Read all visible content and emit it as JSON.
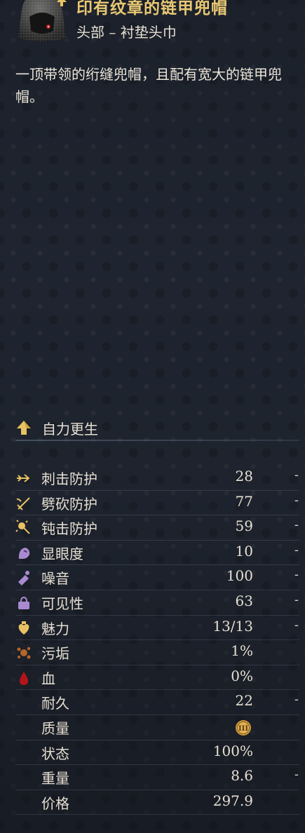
{
  "item": {
    "title": "印有纹章的链甲兜帽",
    "subtitle": "头部 – 衬垫头巾",
    "description": "一顶带领的绗缝兜帽，且配有宽大的链甲兜帽。"
  },
  "regen_label": "自力更生",
  "stats": [
    {
      "name": "刺击防护",
      "value": "28",
      "diff": "-",
      "icon": "stab-icon"
    },
    {
      "name": "劈砍防护",
      "value": "77",
      "diff": "-",
      "icon": "slash-icon"
    },
    {
      "name": "钝击防护",
      "value": "59",
      "diff": "-",
      "icon": "blunt-icon"
    },
    {
      "name": "显眼度",
      "value": "10",
      "diff": "-",
      "icon": "conspicuousness-icon"
    },
    {
      "name": "噪音",
      "value": "100",
      "diff": "-",
      "icon": "noise-icon"
    },
    {
      "name": "可见性",
      "value": "63",
      "diff": "-",
      "icon": "visibility-icon"
    },
    {
      "name": "魅力",
      "value": "13/13",
      "diff": "-",
      "icon": "charisma-icon"
    },
    {
      "name": "污垢",
      "value": "1%",
      "diff": "",
      "icon": "dirt-icon"
    },
    {
      "name": "血",
      "value": "0%",
      "diff": "",
      "icon": "blood-icon"
    },
    {
      "name": "耐久",
      "value": "22",
      "diff": "-",
      "icon": ""
    },
    {
      "name": "质量",
      "value": "",
      "diff": "",
      "icon": "",
      "quality_coin": "III"
    },
    {
      "name": "状态",
      "value": "100%",
      "diff": "",
      "icon": ""
    },
    {
      "name": "重量",
      "value": "8.6",
      "diff": "-",
      "icon": ""
    },
    {
      "name": "价格",
      "value": "297.9",
      "diff": "",
      "icon": ""
    }
  ],
  "colors": {
    "title_gold": "#e9c873",
    "icon_yellow": "#e8c261",
    "icon_purple": "#a98ad0",
    "blood_red": "#b3141a",
    "background": "#1f2531"
  }
}
